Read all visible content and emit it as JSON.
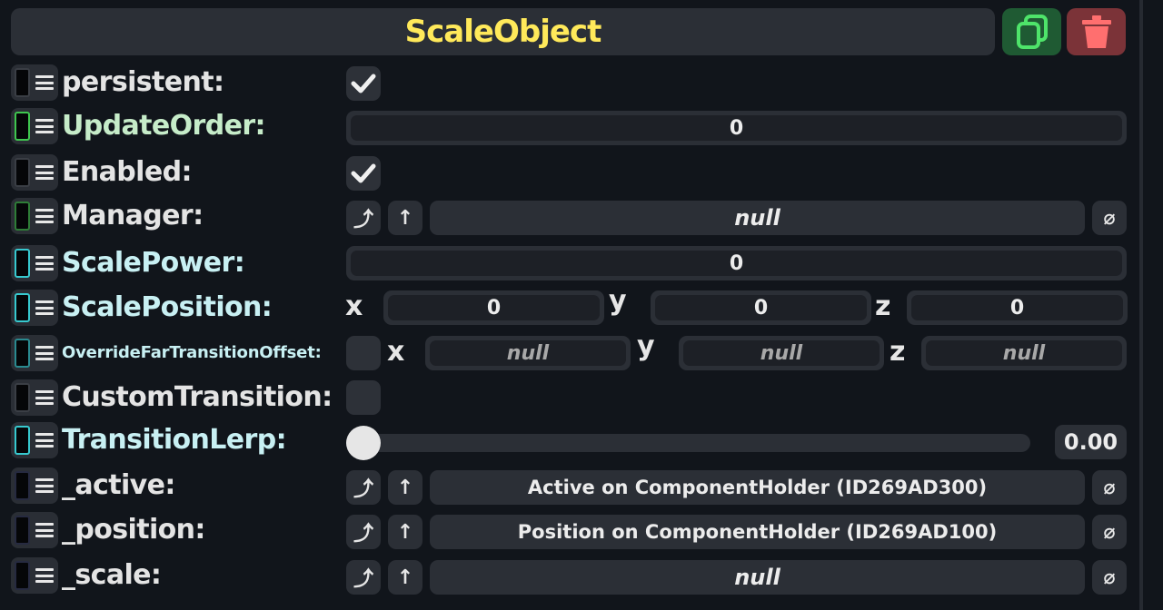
{
  "header": {
    "title": "ScaleObject",
    "duplicate_icon": "duplicate-icon",
    "delete_icon": "trash-icon",
    "colors": {
      "title": "#ffe95a",
      "duplicate_bg": "#1f5a33",
      "duplicate_fg": "#4ee46a",
      "delete_bg": "#7b3338",
      "delete_fg": "#ff6f6f"
    }
  },
  "fields": {
    "persistent": {
      "label": "persistent:",
      "checked": true
    },
    "update_order": {
      "label": "UpdateOrder:",
      "value": "0"
    },
    "enabled": {
      "label": "Enabled:",
      "checked": true
    },
    "manager": {
      "label": "Manager:",
      "value": "null"
    },
    "scale_power": {
      "label": "ScalePower:",
      "value": "0"
    },
    "scale_position": {
      "label": "ScalePosition:",
      "x_label": "x",
      "y_label": "y",
      "z_label": "z",
      "x": "0",
      "y": "0",
      "z": "0"
    },
    "override_far": {
      "label": "OverrideFarTransitionOffset:",
      "checked": false,
      "x_label": "x",
      "y_label": "y",
      "z_label": "z",
      "x": "null",
      "y": "null",
      "z": "null"
    },
    "custom_transition": {
      "label": "CustomTransition:",
      "checked": false
    },
    "transition_lerp": {
      "label": "TransitionLerp:",
      "value": "0.00",
      "fraction": 0
    },
    "active": {
      "label": "_active:",
      "value": "Active on ComponentHolder (ID269AD300)"
    },
    "position": {
      "label": "_position:",
      "value": "Position on ComponentHolder (ID269AD100)"
    },
    "scale": {
      "label": "_scale:",
      "value": "null"
    }
  },
  "icons": {
    "jump": "⤴",
    "up": "↑",
    "clear": "⌀"
  }
}
